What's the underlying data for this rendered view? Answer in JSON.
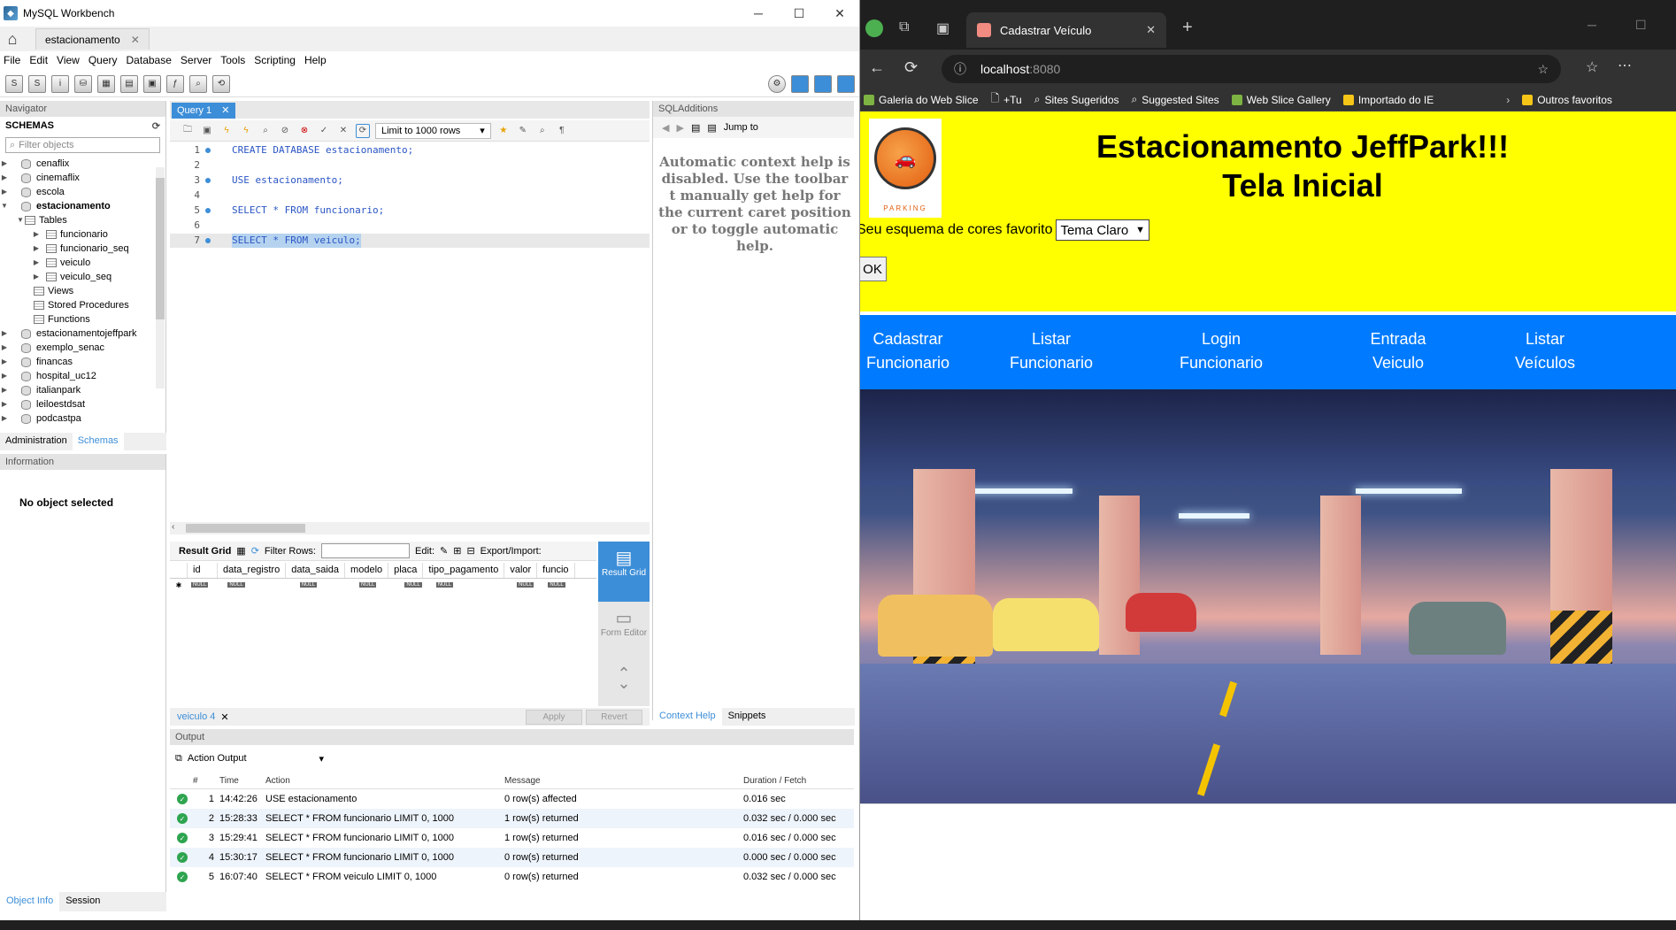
{
  "workbench": {
    "title": "MySQL Workbench",
    "connection_tab": "estacionamento",
    "menu": [
      "File",
      "Edit",
      "View",
      "Query",
      "Database",
      "Server",
      "Tools",
      "Scripting",
      "Help"
    ],
    "navigator_label": "Navigator",
    "schemas_label": "SCHEMAS",
    "filter_placeholder": "Filter objects",
    "schemas": [
      "cenaflix",
      "cinemaflix",
      "escola",
      "estacionamento"
    ],
    "active_schema_children": {
      "tables_label": "Tables",
      "tables": [
        "funcionario",
        "funcionario_seq",
        "veiculo",
        "veiculo_seq"
      ],
      "views_label": "Views",
      "stored_procedures_label": "Stored Procedures",
      "functions_label": "Functions"
    },
    "more_schemas": [
      "estacionamentojeffpark",
      "exemplo_senac",
      "financas",
      "hospital_uc12",
      "italianpark",
      "leiloestdsat",
      "podcastpa"
    ],
    "nav_tabs": [
      "Administration",
      "Schemas"
    ],
    "information_label": "Information",
    "no_object": "No object selected",
    "info_tabs": [
      "Object Info",
      "Session"
    ],
    "query_tab": "Query 1",
    "limit_label": "Limit to 1000 rows",
    "code_lines": [
      {
        "n": "1",
        "text": "CREATE DATABASE estacionamento;"
      },
      {
        "n": "2",
        "text": ""
      },
      {
        "n": "3",
        "text": "USE estacionamento;"
      },
      {
        "n": "4",
        "text": ""
      },
      {
        "n": "5",
        "text": "SELECT * FROM funcionario;"
      },
      {
        "n": "6",
        "text": ""
      },
      {
        "n": "7",
        "text": "SELECT * FROM veiculo;"
      }
    ],
    "sql_additions_label": "SQLAdditions",
    "jump_to": "Jump to",
    "context_help": "Automatic context help is disabled. Use the toolbar t manually get help for the current caret position or to toggle automatic help.",
    "sqladd_tabs": [
      "Context Help",
      "Snippets"
    ],
    "result_toolbar": {
      "result_grid": "Result Grid",
      "filter_rows": "Filter Rows:",
      "edit": "Edit:",
      "export_import": "Export/Import:"
    },
    "result_columns": [
      "id",
      "data_registro",
      "data_saida",
      "modelo",
      "placa",
      "tipo_pagamento",
      "valor",
      "funcio"
    ],
    "null_text": "NULL",
    "result_side": [
      "Result Grid",
      "Form Editor"
    ],
    "result_tab": "veiculo 4",
    "apply_label": "Apply",
    "revert_label": "Revert",
    "output_label": "Output",
    "action_output": "Action Output",
    "output_headers": [
      "#",
      "Time",
      "Action",
      "Message",
      "Duration / Fetch"
    ],
    "output_rows": [
      {
        "n": "1",
        "time": "14:42:26",
        "action": "USE estacionamento",
        "message": "0 row(s) affected",
        "duration": "0.016 sec"
      },
      {
        "n": "2",
        "time": "15:28:33",
        "action": "SELECT * FROM funcionario LIMIT 0, 1000",
        "message": "1 row(s) returned",
        "duration": "0.032 sec / 0.000 sec"
      },
      {
        "n": "3",
        "time": "15:29:41",
        "action": "SELECT * FROM funcionario LIMIT 0, 1000",
        "message": "1 row(s) returned",
        "duration": "0.016 sec / 0.000 sec"
      },
      {
        "n": "4",
        "time": "15:30:17",
        "action": "SELECT * FROM funcionario LIMIT 0, 1000",
        "message": "0 row(s) returned",
        "duration": "0.000 sec / 0.000 sec"
      },
      {
        "n": "5",
        "time": "16:07:40",
        "action": "SELECT * FROM veiculo LIMIT 0, 1000",
        "message": "0 row(s) returned",
        "duration": "0.032 sec / 0.000 sec"
      }
    ]
  },
  "browser": {
    "tab_title": "Cadastrar Veículo",
    "url_host": "localhost",
    "url_port": ":8080",
    "favorites": [
      "Galeria do Web Slice",
      "+Tu",
      "Sites Sugeridos",
      "Suggested Sites",
      "Web Slice Gallery",
      "Importado do IE",
      "Outros favoritos"
    ],
    "page": {
      "logo_text": "PARKING",
      "title_line1": "Estacionamento JeffPark!!!",
      "title_line2": "Tela Inicial",
      "theme_label": "Seu esquema de cores favorito",
      "theme_value": "Tema Claro",
      "ok_label": "OK",
      "nav": [
        {
          "l1": "Cadastrar",
          "l2": "Funcionario"
        },
        {
          "l1": "Listar",
          "l2": "Funcionario"
        },
        {
          "l1": "Login",
          "l2": "Funcionario"
        },
        {
          "l1": "Entrada",
          "l2": "Veiculo"
        },
        {
          "l1": "Listar",
          "l2": "Veículos"
        }
      ]
    }
  },
  "colors": {
    "yellow": "#ffff00",
    "nav_blue": "#007bff",
    "wb_accent": "#3d8ed8"
  }
}
